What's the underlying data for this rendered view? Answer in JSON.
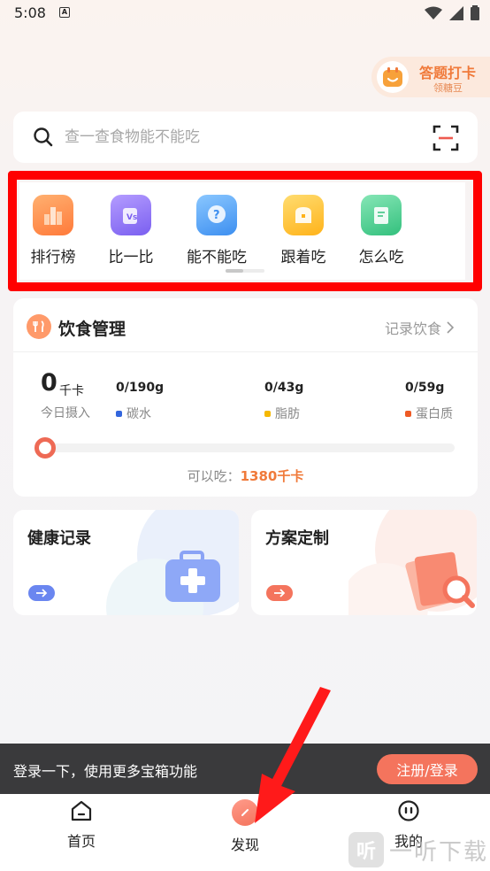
{
  "status_bar": {
    "time": "5:08",
    "notification": "A"
  },
  "quiz_badge": {
    "title": "答题打卡",
    "subtitle": "领糖豆"
  },
  "search": {
    "placeholder": "查一查食物能不能吃"
  },
  "shortcuts": [
    {
      "label": "排行榜",
      "icon": "ranking-icon",
      "color": "#ff8c4a"
    },
    {
      "label": "比一比",
      "icon": "compare-icon",
      "color": "#8f73f2"
    },
    {
      "label": "能不能吃",
      "icon": "question-icon",
      "color": "#4fa3f5"
    },
    {
      "label": "跟着吃",
      "icon": "bread-icon",
      "color": "#ffc53d"
    },
    {
      "label": "怎么吃",
      "icon": "recipe-icon",
      "color": "#4ccc8f"
    }
  ],
  "diet": {
    "title": "饮食管理",
    "link": "记录饮食",
    "kcal": "0",
    "kcal_unit": "千卡",
    "today_label": "今日摄入",
    "nutrients": [
      {
        "value": "0/190g",
        "label": "碳水",
        "color": "#3366dd"
      },
      {
        "value": "0/43g",
        "label": "脂肪",
        "color": "#f5b800"
      },
      {
        "value": "0/59g",
        "label": "蛋白质",
        "color": "#ee5a24"
      }
    ],
    "progress": 0,
    "can_eat_label": "可以吃：",
    "can_eat_value": "1380千卡"
  },
  "cards": [
    {
      "title": "健康记录",
      "arrow_color": "#6a86f0"
    },
    {
      "title": "方案定制",
      "arrow_color": "#f4745d"
    }
  ],
  "login_bar": {
    "text": "登录一下，使用更多宝箱功能",
    "button": "注册/登录"
  },
  "bottom_nav": [
    {
      "label": "首页",
      "icon": "home-icon"
    },
    {
      "label": "发现",
      "icon": "discover-icon"
    },
    {
      "label": "我的",
      "icon": "profile-icon"
    }
  ],
  "watermark": {
    "logo": "听",
    "text": "一听下载"
  }
}
